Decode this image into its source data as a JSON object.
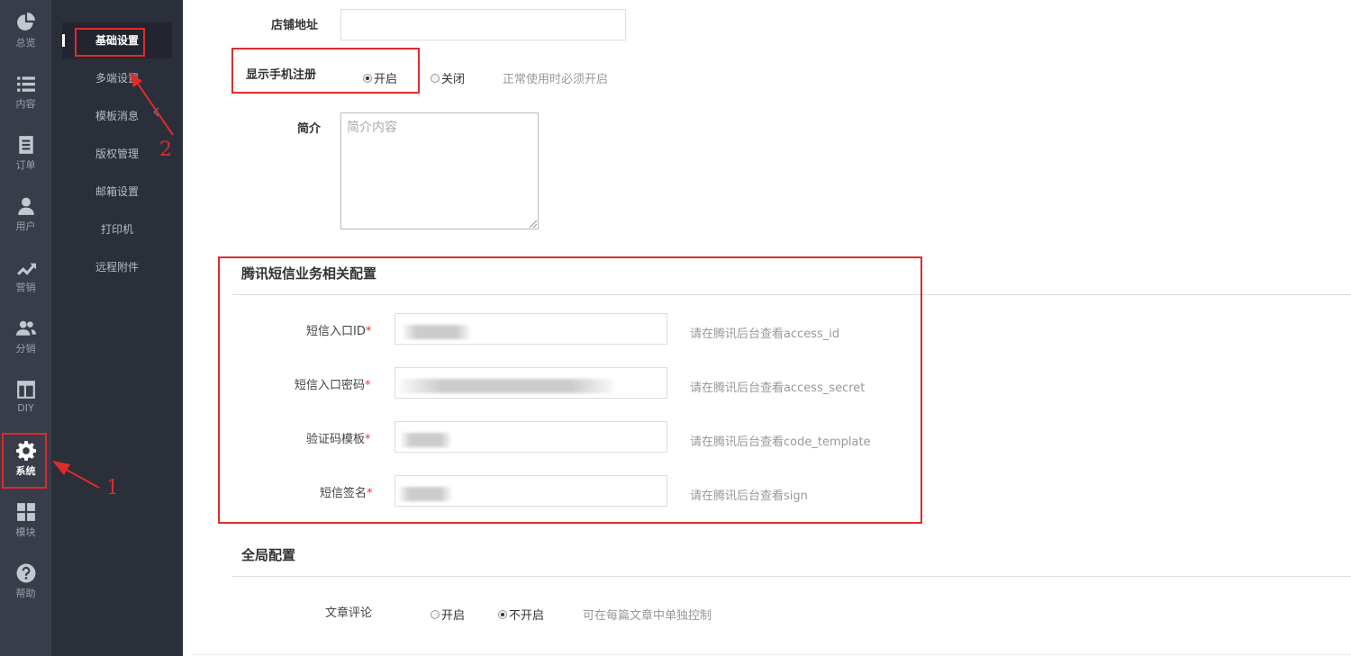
{
  "rail": {
    "items": [
      {
        "label": "总览"
      },
      {
        "label": "内容"
      },
      {
        "label": "订单"
      },
      {
        "label": "用户"
      },
      {
        "label": "营销"
      },
      {
        "label": "分销"
      },
      {
        "label": "DIY"
      },
      {
        "label": "系统"
      },
      {
        "label": "模块"
      },
      {
        "label": "帮助"
      }
    ]
  },
  "subnav": {
    "items": [
      {
        "label": "基础设置"
      },
      {
        "label": "多端设置"
      },
      {
        "label": "模板消息"
      },
      {
        "label": "版权管理"
      },
      {
        "label": "邮箱设置"
      },
      {
        "label": "打印机"
      },
      {
        "label": "远程附件"
      }
    ]
  },
  "form": {
    "shop_address_label": "店铺地址",
    "phone_register_label": "显示手机注册",
    "phone_register_on": "开启",
    "phone_register_off": "关闭",
    "phone_register_hint": "正常使用时必须开启",
    "intro_label": "简介",
    "intro_placeholder": "简介内容"
  },
  "sms": {
    "title": "腾讯短信业务相关配置",
    "fields": [
      {
        "label": "短信入口ID",
        "required": "*",
        "hint": "请在腾讯后台查看access_id"
      },
      {
        "label": "短信入口密码",
        "required": "*",
        "hint": "请在腾讯后台查看access_secret"
      },
      {
        "label": "验证码模板",
        "required": "*",
        "hint": "请在腾讯后台查看code_template"
      },
      {
        "label": "短信签名",
        "required": "*",
        "hint": "请在腾讯后台查看sign"
      }
    ]
  },
  "global": {
    "title": "全局配置",
    "comment_label": "文章评论",
    "comment_on": "开启",
    "comment_off": "不开启",
    "comment_hint": "可在每篇文章中单独控制"
  },
  "annotations": {
    "one": "1",
    "two": "2",
    "color": "#e02b2b"
  },
  "colors": {
    "rail_bg": "#393d49",
    "subnav_bg": "#2b2f3a",
    "required": "#e33"
  }
}
